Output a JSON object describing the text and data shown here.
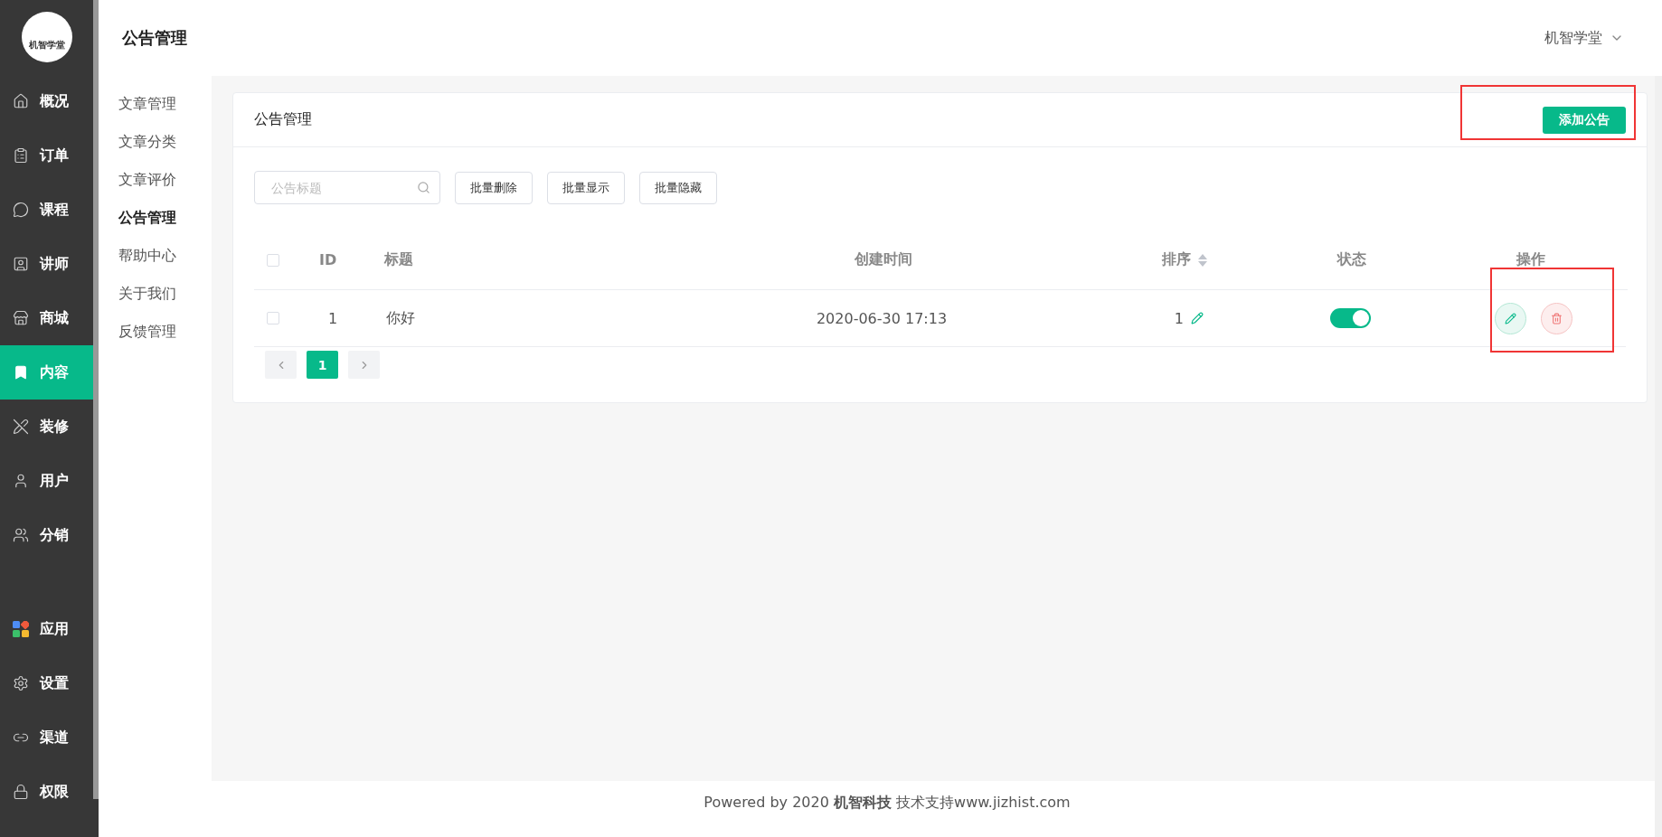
{
  "logo": {
    "text": "机智学堂"
  },
  "nav_main": [
    {
      "label": "概况",
      "selected": false
    },
    {
      "label": "订单",
      "selected": false
    },
    {
      "label": "课程",
      "selected": false
    },
    {
      "label": "讲师",
      "selected": false
    },
    {
      "label": "商城",
      "selected": false
    },
    {
      "label": "内容",
      "selected": true
    },
    {
      "label": "装修",
      "selected": false
    },
    {
      "label": "用户",
      "selected": false
    },
    {
      "label": "分销",
      "selected": false
    }
  ],
  "nav_bottom": [
    {
      "label": "应用",
      "selected": false
    },
    {
      "label": "设置",
      "selected": false
    },
    {
      "label": "渠道",
      "selected": false
    },
    {
      "label": "权限",
      "selected": false
    }
  ],
  "header": {
    "title": "公告管理",
    "account": "机智学堂"
  },
  "submenu": [
    {
      "label": "文章管理",
      "selected": false
    },
    {
      "label": "文章分类",
      "selected": false
    },
    {
      "label": "文章评价",
      "selected": false
    },
    {
      "label": "公告管理",
      "selected": true
    },
    {
      "label": "帮助中心",
      "selected": false
    },
    {
      "label": "关于我们",
      "selected": false
    },
    {
      "label": "反馈管理",
      "selected": false
    }
  ],
  "card": {
    "title": "公告管理",
    "add_button": "添加公告"
  },
  "search": {
    "placeholder": "公告标题"
  },
  "actions": [
    "批量删除",
    "批量显示",
    "批量隐藏"
  ],
  "table": {
    "columns": [
      "ID",
      "标题",
      "创建时间",
      "排序",
      "状态",
      "操作"
    ],
    "header_checked": false,
    "rows": [
      {
        "checked": false,
        "id": "1",
        "title": "你好",
        "created": "2020-06-30 17:13",
        "sort": "1",
        "on": true
      }
    ]
  },
  "pagination": {
    "pages": [
      {
        "label": "1",
        "selected": true
      }
    ]
  },
  "footer": "Powered by 2020 **机智科技** 技术支持www.jizhist.com"
}
